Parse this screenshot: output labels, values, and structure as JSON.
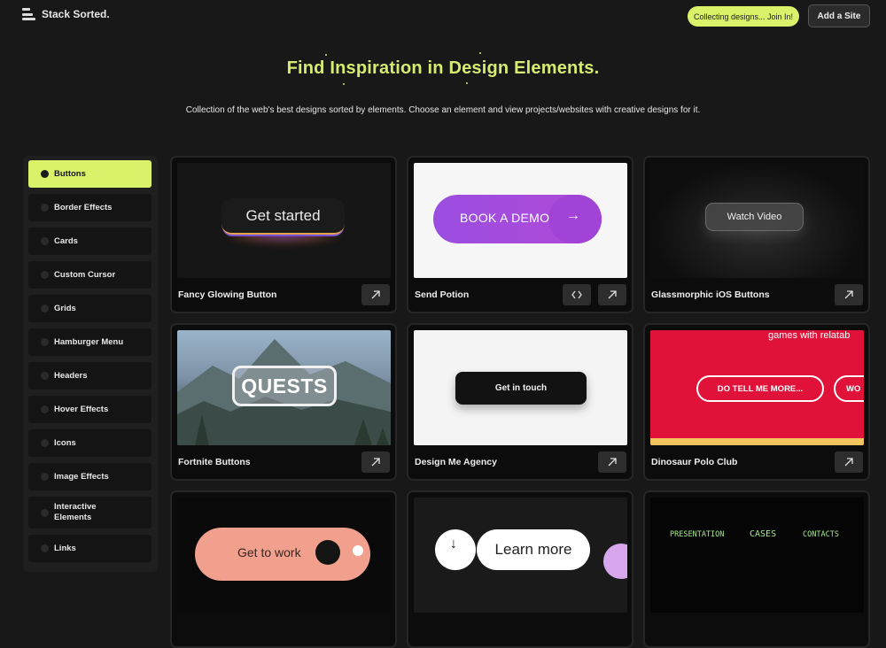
{
  "header": {
    "brand": "Stack Sorted.",
    "collecting_pill": "Collecting designs... Join In!",
    "add_site": "Add a Site"
  },
  "hero": {
    "title": "Find Inspiration in Design Elements.",
    "subtitle": "Collection of the web's best designs sorted by elements. Choose an element and view projects/websites with creative designs for it."
  },
  "sidebar": {
    "items": [
      {
        "label": "Buttons",
        "active": true
      },
      {
        "label": "Border Effects"
      },
      {
        "label": "Cards"
      },
      {
        "label": "Custom Cursor"
      },
      {
        "label": "Grids"
      },
      {
        "label": "Hamburger Menu"
      },
      {
        "label": "Headers"
      },
      {
        "label": "Hover Effects"
      },
      {
        "label": "Icons"
      },
      {
        "label": "Image Effects"
      },
      {
        "label": "Interactive Elements"
      },
      {
        "label": "Links"
      }
    ]
  },
  "cards": [
    {
      "title": "Fancy Glowing Button",
      "preview_text": "Get started"
    },
    {
      "title": "Send Potion",
      "preview_text": "BOOK A DEMO"
    },
    {
      "title": "Glassmorphic iOS Buttons",
      "preview_text": "Watch Video"
    },
    {
      "title": "Fortnite Buttons",
      "preview_text": "QUESTS"
    },
    {
      "title": "Design Me Agency",
      "preview_text": "Get in touch"
    },
    {
      "title": "Dinosaur Polo Club",
      "preview_text": "DO TELL ME MORE...",
      "preview_text_2": "games with relatab",
      "preview_text_3": "WO"
    },
    {
      "title": "",
      "preview_text": "Get to work"
    },
    {
      "title": "",
      "preview_text": "Learn more"
    },
    {
      "title": "",
      "preview_nav": [
        "PRESENTATION",
        "CASES",
        "CONTACTS"
      ]
    }
  ],
  "icons": {
    "logo": "stack-icon",
    "external_link": "arrow-up-right-icon",
    "code": "code-brackets-icon"
  },
  "colors": {
    "accent": "#d9f26a",
    "background": "#181818",
    "card_background": "#0c0c0c",
    "potion_purple": "#a24ee0",
    "dinosaur_red": "#e0123a"
  }
}
